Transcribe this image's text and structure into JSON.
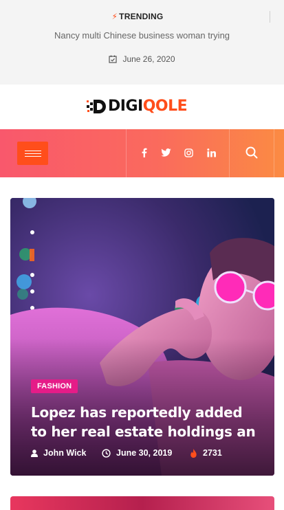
{
  "trending": {
    "label": "TRENDING",
    "icon": "bolt-icon",
    "headline": "Nancy multi Chinese business woman trying",
    "date": "June 26, 2020"
  },
  "brand": {
    "name_dark": "DIGI",
    "name_accent": "QOLE",
    "accent_color": "#ff4e1b"
  },
  "nav": {
    "menu_icon": "hamburger-icon",
    "social": [
      "facebook-icon",
      "twitter-icon",
      "instagram-icon",
      "linkedin-icon"
    ],
    "search_icon": "search-icon",
    "gradient": [
      "#f9586c",
      "#fb8b43"
    ]
  },
  "feature": {
    "category": "FASHION",
    "category_color": "#e51c88",
    "title": "Lopez has reportedly added to her real estate holdings an",
    "author": "John Wick",
    "date": "June 30, 2019",
    "views": "2731"
  }
}
